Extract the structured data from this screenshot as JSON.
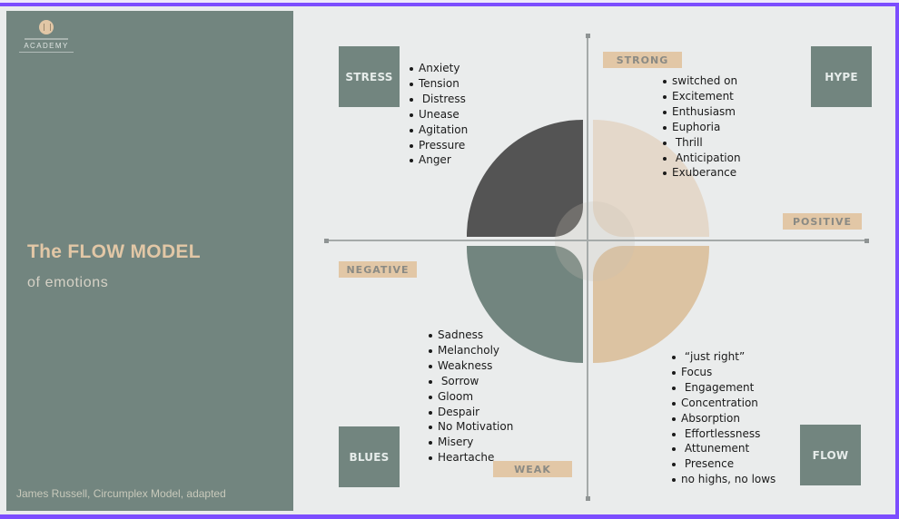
{
  "branding": {
    "academy_label": "ACADEMY"
  },
  "title": {
    "main": "The FLOW MODEL",
    "sub": "of emotions"
  },
  "credit": "James Russell, Circumplex Model, adapted",
  "axes": {
    "top": "STRONG",
    "bottom": "WEAK",
    "left": "NEGATIVE",
    "right": "POSITIVE"
  },
  "quadrants": {
    "stress": {
      "label": "STRESS",
      "items": [
        "Anxiety",
        "Tension",
        " Distress",
        "Unease",
        "Agitation",
        "Pressure",
        "Anger"
      ]
    },
    "hype": {
      "label": "HYPE",
      "items": [
        "switched on",
        "Excitement",
        "Enthusiasm",
        "Euphoria",
        " Thrill",
        " Anticipation",
        "Exuberance"
      ]
    },
    "blues": {
      "label": "BLUES",
      "items": [
        "Sadness",
        "Melancholy",
        "Weakness",
        " Sorrow",
        "Gloom",
        "Despair",
        "No Motivation",
        "Misery",
        "Heartache"
      ]
    },
    "flow": {
      "label": "FLOW",
      "items": [
        " “just right”",
        "Focus",
        " Engagement",
        "Concentration",
        "Absorption",
        " Effortlessness",
        " Attunement",
        " Presence",
        "no highs, no lows"
      ]
    }
  },
  "colors": {
    "panel": "#72857f",
    "accent_tan": "#e2c7a6",
    "stress_petal": "#545454",
    "hype_petal": "#e4d8ca",
    "blues_petal": "#72857f",
    "flow_petal": "#dcc3a2",
    "frame": "#7c4dff"
  }
}
